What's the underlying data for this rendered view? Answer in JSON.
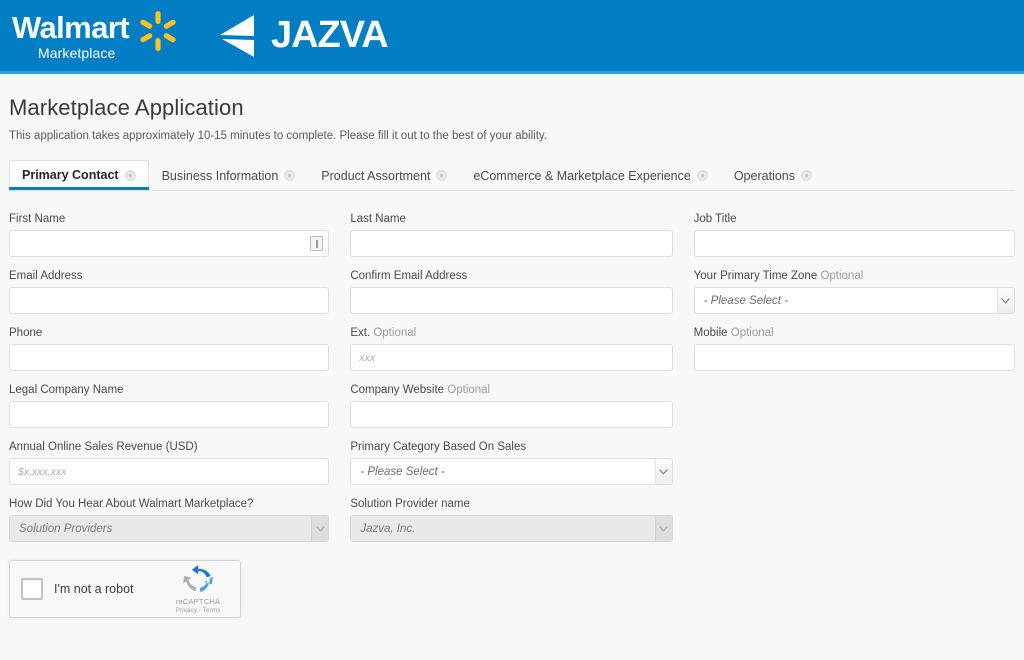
{
  "header": {
    "walmart_name": "Walmart",
    "walmart_sub": "Marketplace",
    "partner_name": "JAZVA",
    "brand_blue": "#007dc3",
    "spark_yellow": "#ffc220"
  },
  "page": {
    "title": "Marketplace Application",
    "subtitle": "This application takes approximately 10-15 minutes to complete. Please fill it out to the best of your ability."
  },
  "tabs": [
    {
      "label": "Primary Contact",
      "active": true
    },
    {
      "label": "Business Information",
      "active": false
    },
    {
      "label": "Product Assortment",
      "active": false
    },
    {
      "label": "eCommerce & Marketplace Experience",
      "active": false
    },
    {
      "label": "Operations",
      "active": false
    }
  ],
  "form": {
    "rows": [
      {
        "fields": [
          {
            "label": "First Name",
            "optional": "",
            "type": "text",
            "value": "",
            "placeholder": "",
            "autofill_icon": true
          },
          {
            "label": "Last Name",
            "optional": "",
            "type": "text",
            "value": "",
            "placeholder": ""
          },
          {
            "label": "Job Title",
            "optional": "",
            "type": "text",
            "value": "",
            "placeholder": ""
          }
        ]
      },
      {
        "fields": [
          {
            "label": "Email Address",
            "optional": "",
            "type": "text",
            "value": "",
            "placeholder": ""
          },
          {
            "label": "Confirm Email Address",
            "optional": "",
            "type": "text",
            "value": "",
            "placeholder": ""
          },
          {
            "label": "Your Primary Time Zone",
            "optional": "Optional",
            "type": "select",
            "value": "- Please Select -",
            "disabled": false
          }
        ]
      },
      {
        "fields": [
          {
            "label": "Phone",
            "optional": "",
            "type": "text",
            "value": "",
            "placeholder": ""
          },
          {
            "label": "Ext.",
            "optional": "Optional",
            "type": "text",
            "value": "",
            "placeholder": "xxx"
          },
          {
            "label": "Mobile",
            "optional": "Optional",
            "type": "text",
            "value": "",
            "placeholder": ""
          }
        ]
      },
      {
        "fields": [
          {
            "label": "Legal Company Name",
            "optional": "",
            "type": "text",
            "value": "",
            "placeholder": ""
          },
          {
            "label": "Company Website",
            "optional": "Optional",
            "type": "text",
            "value": "",
            "placeholder": ""
          },
          {
            "label": "",
            "optional": "",
            "type": "blank"
          }
        ]
      },
      {
        "fields": [
          {
            "label": "Annual Online Sales Revenue (USD)",
            "optional": "",
            "type": "text",
            "value": "",
            "placeholder": "$x,xxx,xxx"
          },
          {
            "label": "Primary Category Based On Sales",
            "optional": "",
            "type": "select",
            "value": "- Please Select -",
            "disabled": false
          },
          {
            "label": "",
            "optional": "",
            "type": "blank"
          }
        ]
      },
      {
        "fields": [
          {
            "label": "How Did You Hear About Walmart Marketplace?",
            "optional": "",
            "type": "select",
            "value": "Solution Providers",
            "disabled": true
          },
          {
            "label": "Solution Provider name",
            "optional": "",
            "type": "select",
            "value": "Jazva, Inc.",
            "disabled": true
          },
          {
            "label": "",
            "optional": "",
            "type": "blank"
          }
        ]
      }
    ]
  },
  "recaptcha": {
    "label": "I'm not a robot",
    "brand_name": "reCAPTCHA",
    "legal": "Privacy - Terms",
    "checked": false
  }
}
